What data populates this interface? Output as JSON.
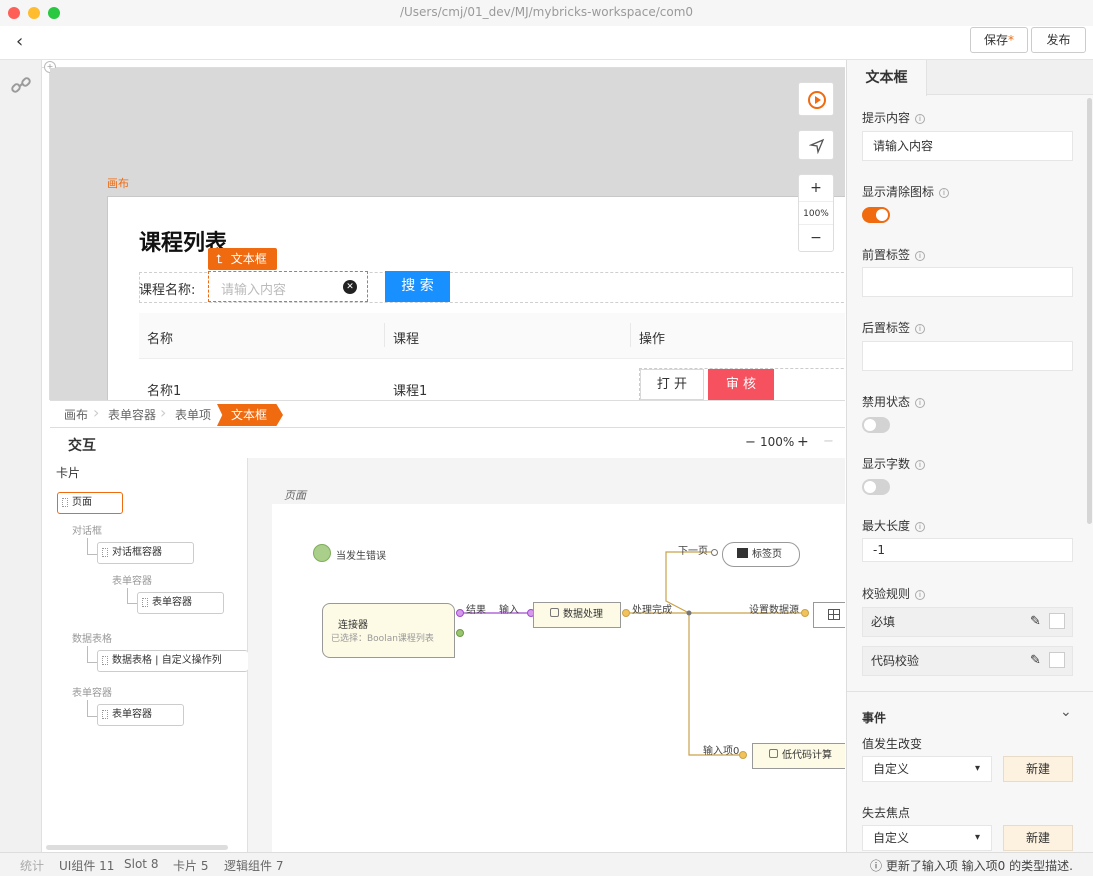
{
  "window": {
    "path": "/Users/cmj/01_dev/MJ/mybricks-workspace/com0"
  },
  "toolbar": {
    "save_label": "保存",
    "save_dirty_mark": "*",
    "publish_label": "发布"
  },
  "stage": {
    "canvas_label": "画布",
    "zoom": "100%",
    "page_title": "课程列表",
    "selected_tag": "文本框",
    "form_label": "课程名称:",
    "input_placeholder": "请输入内容",
    "search_button": "搜 索",
    "table": {
      "headers": [
        "名称",
        "课程",
        "操作"
      ],
      "rows": [
        {
          "name": "名称1",
          "course": "课程1",
          "actions": [
            "打 开",
            "审 核"
          ]
        }
      ]
    }
  },
  "breadcrumb": [
    "画布",
    "表单容器",
    "表单项",
    "文本框"
  ],
  "interaction": {
    "title": "交互",
    "zoom": "100%",
    "cards_title": "卡片",
    "tree": {
      "page": "页面",
      "dialog_group": "对话框",
      "dialog_container": "对话框容器",
      "form_group_1": "表单容器",
      "form_container_1": "表单容器",
      "table_group": "数据表格",
      "table_item": "数据表格 | 自定义操作列",
      "form_group_2": "表单容器",
      "form_container_2": "表单容器"
    },
    "flow": {
      "page_label": "页面",
      "error_event": "当发生错误",
      "connector_title": "连接器",
      "connector_sub": "已选择：Boolan课程列表",
      "port_result": "结果",
      "port_input": "输入",
      "data_process": "数据处理",
      "process_done": "处理完成",
      "set_source": "设置数据源",
      "next_page": "下一页",
      "tab_page": "标签页",
      "input_item0": "输入项0",
      "lowcode": "低代码计算"
    }
  },
  "panel": {
    "tab": "文本框",
    "placeholder_label": "提示内容",
    "placeholder_value": "请输入内容",
    "show_clear_label": "显示清除图标",
    "show_clear": true,
    "prefix_label": "前置标签",
    "prefix_value": "",
    "suffix_label": "后置标签",
    "suffix_value": "",
    "disabled_label": "禁用状态",
    "disabled": false,
    "show_count_label": "显示字数",
    "show_count": false,
    "maxlen_label": "最大长度",
    "maxlen_value": "-1",
    "rules_label": "校验规则",
    "rules": [
      "必填",
      "代码校验"
    ],
    "events_title": "事件",
    "event_change_label": "值发生改变",
    "event_change_value": "自定义",
    "event_blur_label": "失去焦点",
    "event_blur_value": "自定义",
    "new_label": "新建"
  },
  "status": {
    "stats": "统计",
    "ui_components": "UI组件 11",
    "slots": "Slot 8",
    "cards": "卡片 5",
    "logic": "逻辑组件 7",
    "message": "ⓘ 更新了输入项 输入项0 的类型描述."
  },
  "colors": {
    "accent": "#f06a0f",
    "primary": "#1890ff",
    "danger": "#f5515f",
    "switch_on": "#f06a0f",
    "switch_off": "#d3d3d3"
  }
}
